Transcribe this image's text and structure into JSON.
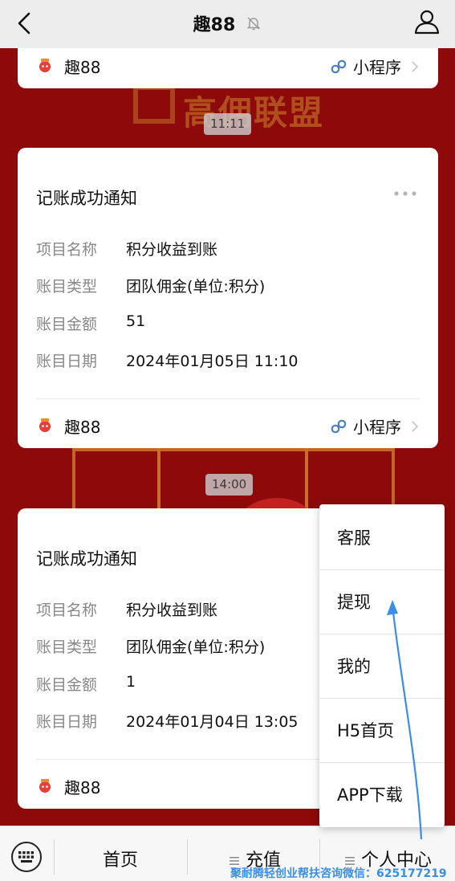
{
  "navbar": {
    "title": "趣88"
  },
  "background": {
    "brand_text": "高佣联盟"
  },
  "top_card": {
    "app_name": "趣88",
    "mini_program_label": "小程序"
  },
  "messages": [
    {
      "time": "11:11",
      "title": "记账成功通知",
      "fields": [
        {
          "label": "项目名称",
          "value": "积分收益到账"
        },
        {
          "label": "账目类型",
          "value": "团队佣金(单位:积分)"
        },
        {
          "label": "账目金额",
          "value": "51"
        },
        {
          "label": "账目日期",
          "value": "2024年01月05日 11:10"
        }
      ],
      "app_name": "趣88",
      "mini_program_label": "小程序"
    },
    {
      "time": "14:00",
      "title": "记账成功通知",
      "fields": [
        {
          "label": "项目名称",
          "value": "积分收益到账"
        },
        {
          "label": "账目类型",
          "value": "团队佣金(单位:积分)"
        },
        {
          "label": "账目金额",
          "value": "1"
        },
        {
          "label": "账目日期",
          "value": "2024年01月04日 13:05"
        }
      ],
      "app_name": "趣88"
    }
  ],
  "popup_menu": {
    "items": [
      "客服",
      "提现",
      "我的",
      "H5首页",
      "APP下载"
    ]
  },
  "tabbar": {
    "tabs": [
      "首页",
      "充值",
      "个人中心"
    ]
  },
  "watermark": "聚耐腾轻创业帮扶咨询微信：625177219",
  "colors": {
    "background_red": "#8e0a0a",
    "annotation_arrow": "#3a8ee8",
    "mini_program_icon": "#4a7fc1"
  }
}
